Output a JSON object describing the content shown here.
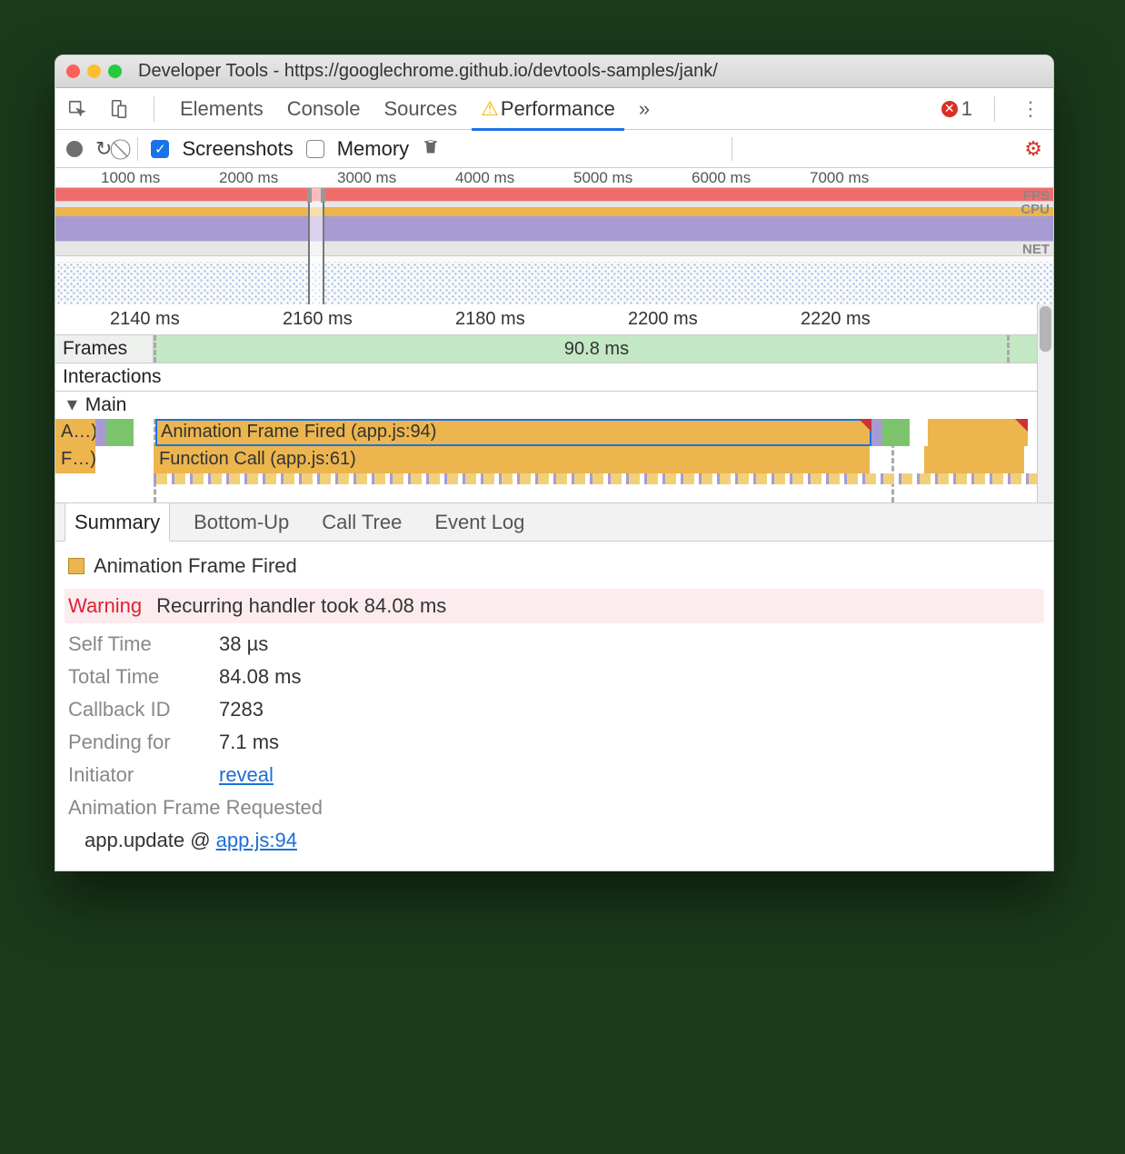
{
  "window": {
    "title": "Developer Tools - https://googlechrome.github.io/devtools-samples/jank/"
  },
  "tabs": {
    "elements": "Elements",
    "console": "Console",
    "sources": "Sources",
    "performance": "Performance",
    "more": "»",
    "error_count": "1"
  },
  "toolbar": {
    "screenshots": "Screenshots",
    "memory": "Memory"
  },
  "overview": {
    "ticks": [
      "1000 ms",
      "2000 ms",
      "3000 ms",
      "4000 ms",
      "5000 ms",
      "6000 ms",
      "7000 ms"
    ],
    "labels": {
      "fps": "FPS",
      "cpu": "CPU",
      "net": "NET"
    }
  },
  "zoom": {
    "ticks": [
      "2140 ms",
      "2160 ms",
      "2180 ms",
      "2200 ms",
      "2220 ms"
    ]
  },
  "tracks": {
    "frames": "Frames",
    "frames_value": "90.8 ms",
    "interactions": "Interactions",
    "main": "Main"
  },
  "flame": {
    "a_trunc": "A…)",
    "af_label": "Animation Frame Fired (app.js:94)",
    "f_trunc": "F…)",
    "fc_label": "Function Call (app.js:61)"
  },
  "bottom_tabs": {
    "summary": "Summary",
    "bottom_up": "Bottom-Up",
    "call_tree": "Call Tree",
    "event_log": "Event Log"
  },
  "summary": {
    "title": "Animation Frame Fired",
    "warning_label": "Warning",
    "warning_text": "Recurring handler took 84.08 ms",
    "self_time_label": "Self Time",
    "self_time": "38 µs",
    "total_time_label": "Total Time",
    "total_time": "84.08 ms",
    "callback_id_label": "Callback ID",
    "callback_id": "7283",
    "pending_label": "Pending for",
    "pending": "7.1 ms",
    "initiator_label": "Initiator",
    "initiator_link": "reveal",
    "requested": "Animation Frame Requested",
    "stack_fn": "app.update @ ",
    "stack_link": "app.js:94"
  }
}
